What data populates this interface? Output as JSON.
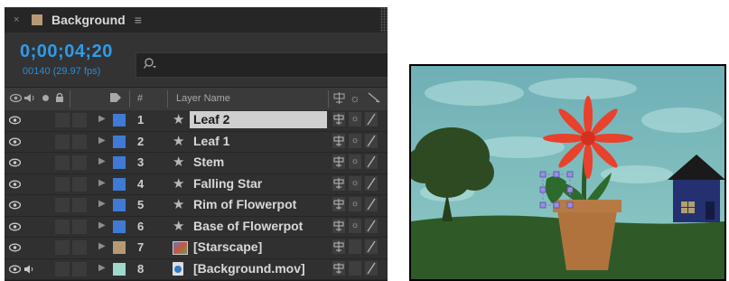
{
  "panel": {
    "tab_close": "×",
    "tab_title": "Background",
    "tab_menu": "≡",
    "timecode": "0;00;04;20",
    "frame_info": "00140 (29.97 fps)",
    "search_icon": "⌕",
    "columns": {
      "number": "#",
      "layer_name": "Layer Name"
    },
    "layers": [
      {
        "num": "1",
        "name": "Leaf 2",
        "icon": "star-icon",
        "label_color": "#3f7bd4",
        "selected": true
      },
      {
        "num": "2",
        "name": "Leaf 1",
        "icon": "star-icon",
        "label_color": "#3f7bd4"
      },
      {
        "num": "3",
        "name": "Stem",
        "icon": "star-icon",
        "label_color": "#3f7bd4"
      },
      {
        "num": "4",
        "name": "Falling Star",
        "icon": "star-icon",
        "label_color": "#3f7bd4"
      },
      {
        "num": "5",
        "name": "Rim of Flowerpot",
        "icon": "star-icon",
        "label_color": "#3f7bd4"
      },
      {
        "num": "6",
        "name": "Base of Flowerpot",
        "icon": "star-icon",
        "label_color": "#3f7bd4"
      },
      {
        "num": "7",
        "name": "[Starscape]",
        "icon": "precomp-icon",
        "label_color": "#b79a74"
      },
      {
        "num": "8",
        "name": "[Background.mov]",
        "icon": "footage-icon",
        "label_color": "#9fd8cc"
      }
    ]
  },
  "colors": {
    "timecode_blue": "#2d9ce8",
    "selected_row": "#cfcfcf",
    "sky": "#7fbcbe",
    "grass": "#2f5a27",
    "pot": "#b0733e",
    "petals": "#e8412c",
    "house": "#253070"
  }
}
